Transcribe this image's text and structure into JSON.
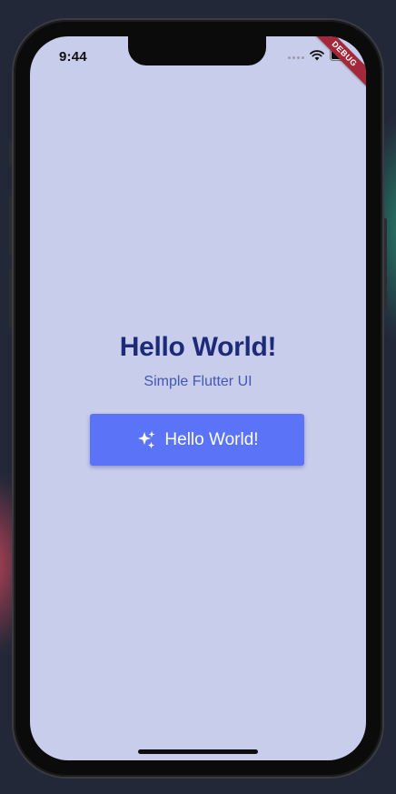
{
  "status_bar": {
    "time": "9:44",
    "icons": [
      "signal-dots-icon",
      "wifi-icon",
      "battery-icon"
    ]
  },
  "debug_banner": {
    "label": "DEBUG",
    "color": "#a3283a"
  },
  "main": {
    "title": "Hello World!",
    "subtitle": "Simple Flutter UI",
    "button": {
      "label": "Hello World!",
      "icon": "sparkles-icon"
    }
  },
  "colors": {
    "background": "#c8cdeb",
    "title": "#1c2a78",
    "subtitle": "#4358b0",
    "button": "#5b74f7",
    "button_text": "#ffffff"
  }
}
